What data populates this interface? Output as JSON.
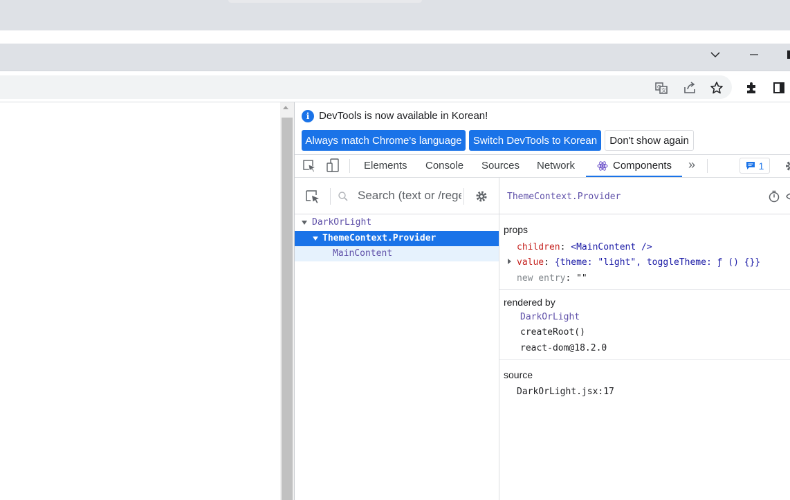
{
  "browser": {
    "window_controls": {
      "tabs_menu": "chevron-down-icon",
      "minimize": "minimize-icon"
    },
    "toolbar_icons": [
      "translate-icon",
      "share-icon",
      "star-icon",
      "extensions-icon",
      "side-panel-icon"
    ]
  },
  "devtools": {
    "infobar": {
      "message": "DevTools is now available in Korean!",
      "btn_match": "Always match Chrome's language",
      "btn_switch": "Switch DevTools to Korean",
      "btn_dismiss": "Don't show again"
    },
    "tabs": {
      "elements": "Elements",
      "console": "Console",
      "sources": "Sources",
      "network": "Network",
      "components": "Components",
      "more": "»",
      "issues_count": "1"
    },
    "components": {
      "search_placeholder": "Search (text or /regex/)",
      "tree": {
        "root": "DarkOrLight",
        "provider": "ThemeContext.Provider",
        "child": "MainContent"
      },
      "selected_name": "ThemeContext.Provider",
      "props": {
        "title": "props",
        "children_key": "children",
        "children_val": "<MainContent />",
        "value_key": "value",
        "value_val": "{theme: \"light\", toggleTheme: ƒ () {}}",
        "new_entry_key": "new entry",
        "new_entry_val": "\"\""
      },
      "rendered_by": {
        "title": "rendered by",
        "owner": "DarkOrLight",
        "create_root": "createRoot()",
        "renderer": "react-dom@18.2.0"
      },
      "source": {
        "title": "source",
        "file": "DarkOrLight.jsx:17"
      }
    }
  },
  "colors": {
    "accent": "#1a73e8",
    "component_name": "#5e4fa8",
    "prop_key": "#c5221f",
    "prop_value": "#1a1aa6"
  }
}
